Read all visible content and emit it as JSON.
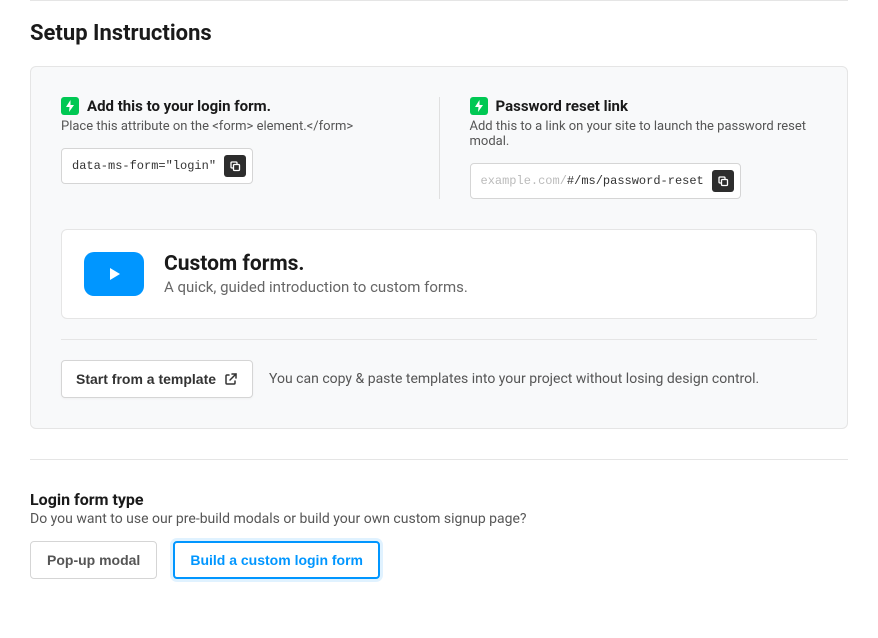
{
  "section_title": "Setup Instructions",
  "login_form": {
    "title": "Add this to your login form.",
    "subtitle": "Place this attribute on the <form> element.</form>",
    "code": "data-ms-form=\"login\""
  },
  "password_reset": {
    "title": "Password reset link",
    "subtitle": "Add this to a link on your site to launch the password reset modal.",
    "code_prefix": "example.com/",
    "code": "#/ms/password-reset"
  },
  "video_card": {
    "title": "Custom forms.",
    "subtitle": "A quick, guided introduction to custom forms."
  },
  "template": {
    "button_label": "Start from a template",
    "description": "You can copy & paste templates into your project without losing design control."
  },
  "form_type": {
    "title": "Login form type",
    "subtitle": "Do you want to use our pre-build modals or build your own custom signup page?",
    "options": {
      "popup": "Pop-up modal",
      "custom": "Build a custom login form"
    }
  }
}
